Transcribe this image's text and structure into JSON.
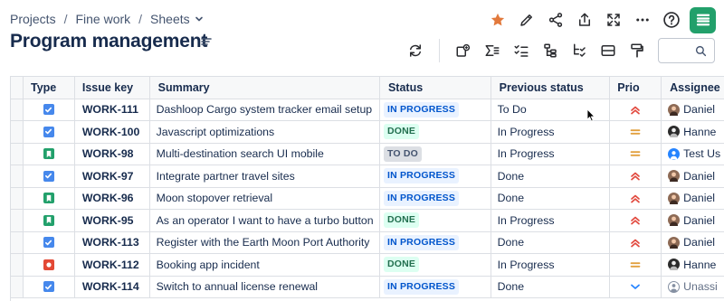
{
  "breadcrumb": {
    "items": [
      "Projects",
      "Fine work",
      "Sheets"
    ],
    "separator": "/"
  },
  "page_title": "Program management",
  "icons": {
    "star_color": "#e2793c",
    "logo_color": "#22a06b"
  },
  "search": {
    "placeholder": "",
    "value": ""
  },
  "table": {
    "columns": [
      "Type",
      "Issue key",
      "Summary",
      "Status",
      "Previous status",
      "Prio",
      "Assignee"
    ],
    "rows": [
      {
        "type": "task",
        "key": "WORK-111",
        "summary": "Dashloop Cargo system tracker email setup",
        "status": "IN PROGRESS",
        "previous": "To Do",
        "priority": "highest",
        "assignee": "Daniel",
        "avatar": "daniel"
      },
      {
        "type": "task",
        "key": "WORK-100",
        "summary": "Javascript optimizations",
        "status": "DONE",
        "previous": "In Progress",
        "priority": "medium",
        "assignee": "Hanne",
        "avatar": "hanne"
      },
      {
        "type": "story",
        "key": "WORK-98",
        "summary": "Multi-destination search UI mobile",
        "status": "TO DO",
        "previous": "In Progress",
        "priority": "medium",
        "assignee": "Test Us",
        "avatar": "test"
      },
      {
        "type": "task",
        "key": "WORK-97",
        "summary": "Integrate partner travel sites",
        "status": "IN PROGRESS",
        "previous": "Done",
        "priority": "highest",
        "assignee": "Daniel",
        "avatar": "daniel"
      },
      {
        "type": "story",
        "key": "WORK-96",
        "summary": "Moon stopover retrieval",
        "status": "IN PROGRESS",
        "previous": "Done",
        "priority": "highest",
        "assignee": "Daniel",
        "avatar": "daniel"
      },
      {
        "type": "story",
        "key": "WORK-95",
        "summary": "As an operator I want to have a turbo button",
        "status": "DONE",
        "previous": "In Progress",
        "priority": "highest",
        "assignee": "Daniel",
        "avatar": "daniel"
      },
      {
        "type": "task",
        "key": "WORK-113",
        "summary": "Register with the Earth Moon Port Authority",
        "status": "IN PROGRESS",
        "previous": "Done",
        "priority": "highest",
        "assignee": "Daniel",
        "avatar": "daniel"
      },
      {
        "type": "bug",
        "key": "WORK-112",
        "summary": "Booking app incident",
        "status": "DONE",
        "previous": "In Progress",
        "priority": "medium",
        "assignee": "Hanne",
        "avatar": "hanne"
      },
      {
        "type": "task",
        "key": "WORK-114",
        "summary": "Switch to annual license renewal",
        "status": "IN PROGRESS",
        "previous": "Done",
        "priority": "low",
        "assignee": "Unassi",
        "avatar": "unassigned"
      }
    ]
  },
  "status_styles": {
    "IN PROGRESS": {
      "bg": "#e9f2ff",
      "fg": "#0055cc"
    },
    "DONE": {
      "bg": "#dcfff1",
      "fg": "#216e4e"
    },
    "TO DO": {
      "bg": "#dcdfe4",
      "fg": "#44546f"
    }
  },
  "type_colors": {
    "task": "#4688ec",
    "story": "#22a06b",
    "bug": "#e34935"
  },
  "priority_colors": {
    "highest": "#e2483d",
    "medium": "#e2a03f",
    "low": "#2684ff"
  }
}
